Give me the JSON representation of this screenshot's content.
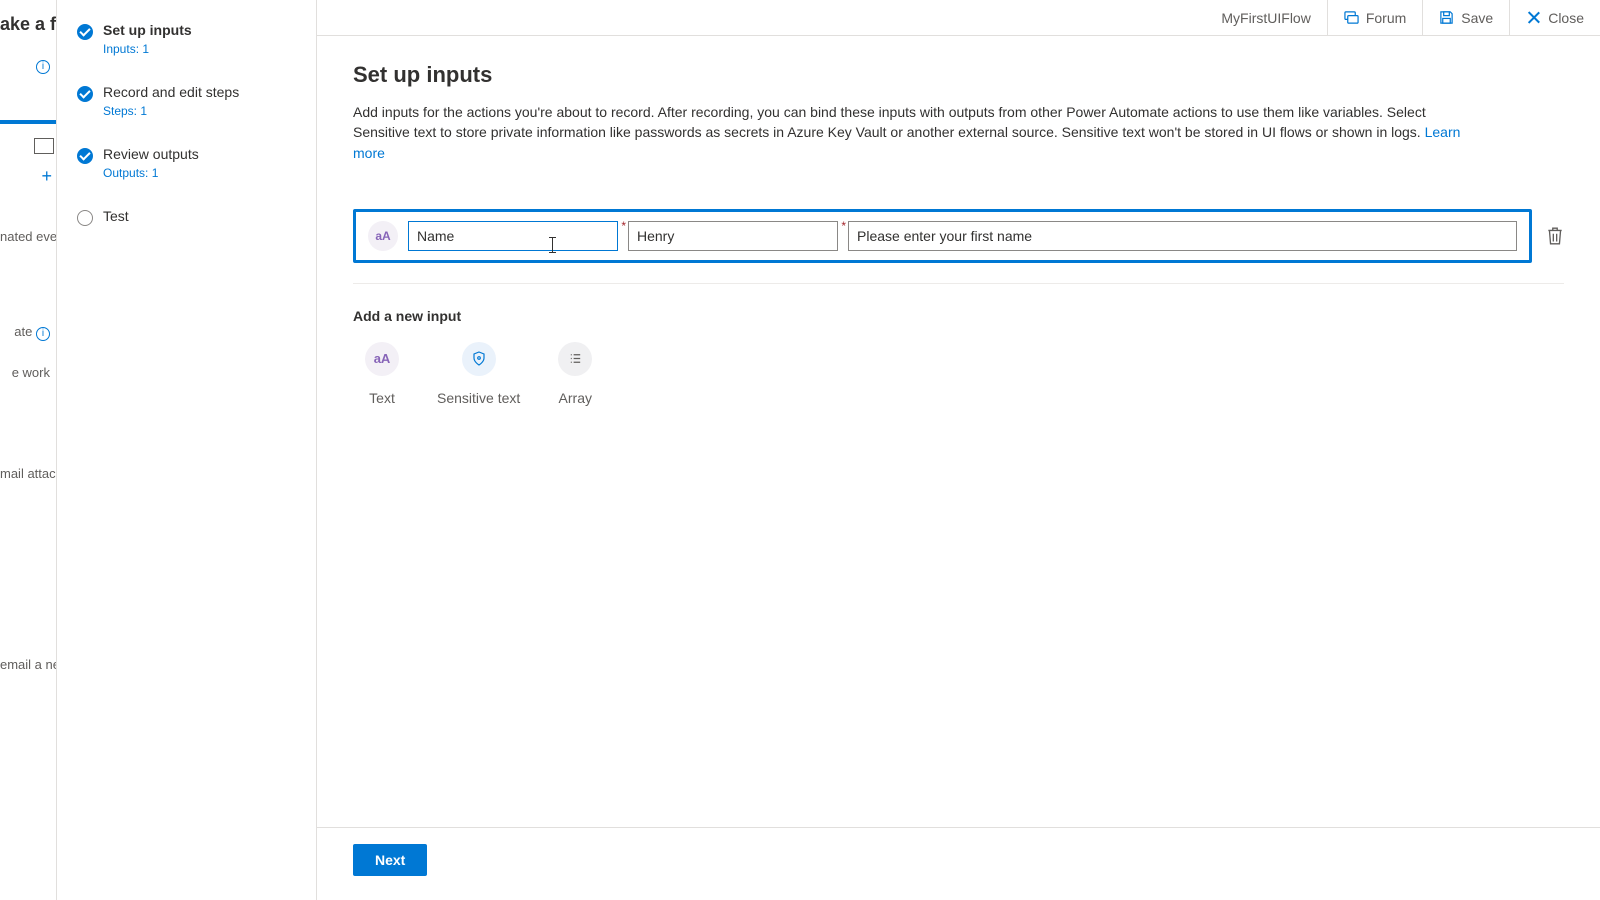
{
  "leftsliver": {
    "title_fragment": "ake a flo",
    "nated": "nated even",
    "ate": "ate",
    "ework": "e work",
    "mailattach": "mail attac",
    "emailnew": "email a ne"
  },
  "wizard": {
    "steps": [
      {
        "name": "Set up inputs",
        "sub": "Inputs: 1",
        "state": "done",
        "active": true
      },
      {
        "name": "Record and edit steps",
        "sub": "Steps: 1",
        "state": "done",
        "active": false
      },
      {
        "name": "Review outputs",
        "sub": "Outputs: 1",
        "state": "done",
        "active": false
      },
      {
        "name": "Test",
        "sub": "",
        "state": "todo",
        "active": false
      }
    ]
  },
  "topbar": {
    "flow_name": "MyFirstUIFlow",
    "forum": "Forum",
    "save": "Save",
    "close": "Close"
  },
  "main": {
    "heading": "Set up inputs",
    "description_pre": "Add inputs for the actions you're about to record. After recording, you can bind these inputs with outputs from other Power Automate actions to use them like variables. Select Sensitive text to store private information like passwords as secrets in Azure Key Vault or another external source. Sensitive text won't be stored in UI flows or shown in logs. ",
    "learn_more": "Learn more",
    "input_row": {
      "type_icon_text": "aA",
      "name_value": "Name",
      "value_value": "Henry",
      "desc_value": "Please enter your first name"
    },
    "add_label": "Add a new input",
    "type_buttons": {
      "text": "Text",
      "sensitive": "Sensitive text",
      "array": "Array",
      "text_icon": "aA"
    },
    "next": "Next"
  }
}
